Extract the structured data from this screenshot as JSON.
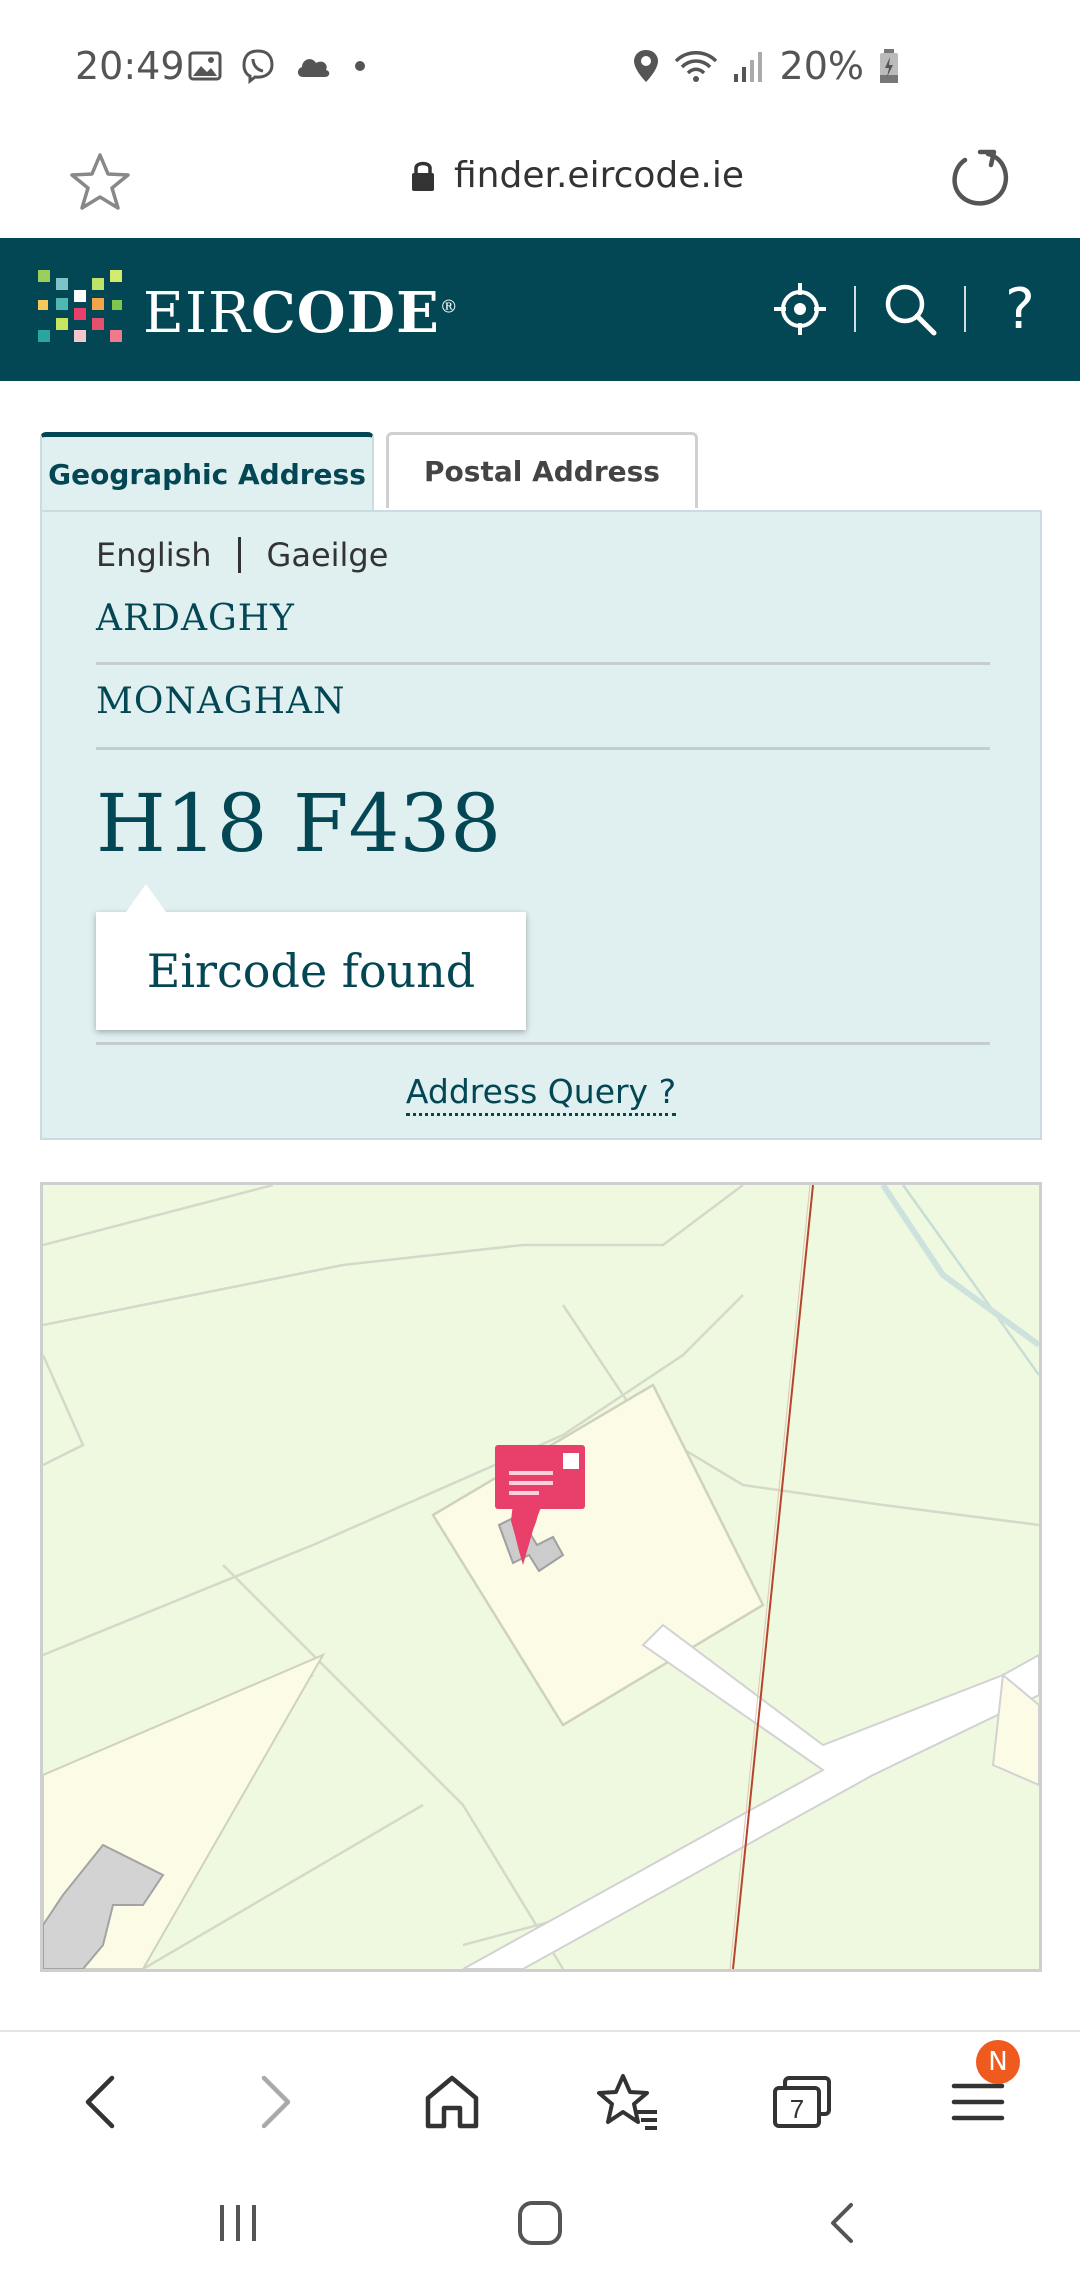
{
  "status_bar": {
    "time": "20:49",
    "battery": "20%",
    "icons": [
      "image-icon",
      "viber-icon",
      "cloud-icon",
      "dot-icon",
      "location-icon",
      "wifi-icon",
      "signal-icon",
      "battery-icon"
    ]
  },
  "browser": {
    "url": "finder.eircode.ie",
    "icons": [
      "star-icon",
      "lock-icon",
      "reload-icon"
    ]
  },
  "site_header": {
    "logo_text_thin": "EIR",
    "logo_text_bold": "CODE",
    "logo_mark": "®",
    "help_label": "?",
    "icons": [
      "locate-icon",
      "search-icon",
      "help-icon"
    ]
  },
  "tabs": [
    {
      "label": "Geographic Address",
      "active": true
    },
    {
      "label": "Postal Address",
      "active": false
    }
  ],
  "panel": {
    "lang_english": "English",
    "lang_irish": "Gaeilge",
    "address_lines": [
      "ARDAGHY",
      "MONAGHAN"
    ],
    "eircode": "H18 F438",
    "tooltip": "Eircode found",
    "query_link": "Address Query ?"
  },
  "colors": {
    "brand_teal": "#044754",
    "panel_bg": "#e0f0f1",
    "map_bg": "#eff9e0",
    "marker": "#e8406a",
    "badge": "#ef5a1e"
  },
  "bottom_nav": {
    "tabs_count": "7",
    "menu_badge": "N",
    "icons": [
      "back-icon",
      "forward-icon",
      "home-icon",
      "bookmarks-icon",
      "tabs-icon",
      "menu-icon"
    ]
  },
  "system_nav": {
    "icons": [
      "recents-icon",
      "home-circle-icon",
      "system-back-icon"
    ]
  }
}
